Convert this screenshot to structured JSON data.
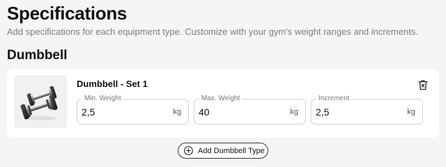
{
  "header": {
    "title": "Specifications",
    "subtitle": "Add specifications for each equipment type. Customize with your gym's weight ranges and increments."
  },
  "section": {
    "title": "Dumbbell",
    "sets": [
      {
        "title": "Dumbbell - Set 1",
        "image_icon": "dumbbell-image",
        "delete_icon": "trash-icon",
        "fields": [
          {
            "label": "Min. Weight",
            "value": "2,5",
            "unit": "kg"
          },
          {
            "label": "Max. Weight",
            "value": "40",
            "unit": "kg"
          },
          {
            "label": "Increment",
            "value": "2,5",
            "unit": "kg"
          }
        ]
      }
    ],
    "add_button": {
      "label": "Add Dumbbell Type",
      "icon": "plus-circle-icon"
    }
  },
  "colors": {
    "background": "#f5f5f5",
    "card": "#ffffff",
    "text": "#111111",
    "muted_text": "#7d7d7d",
    "border": "#d2d2d2"
  }
}
